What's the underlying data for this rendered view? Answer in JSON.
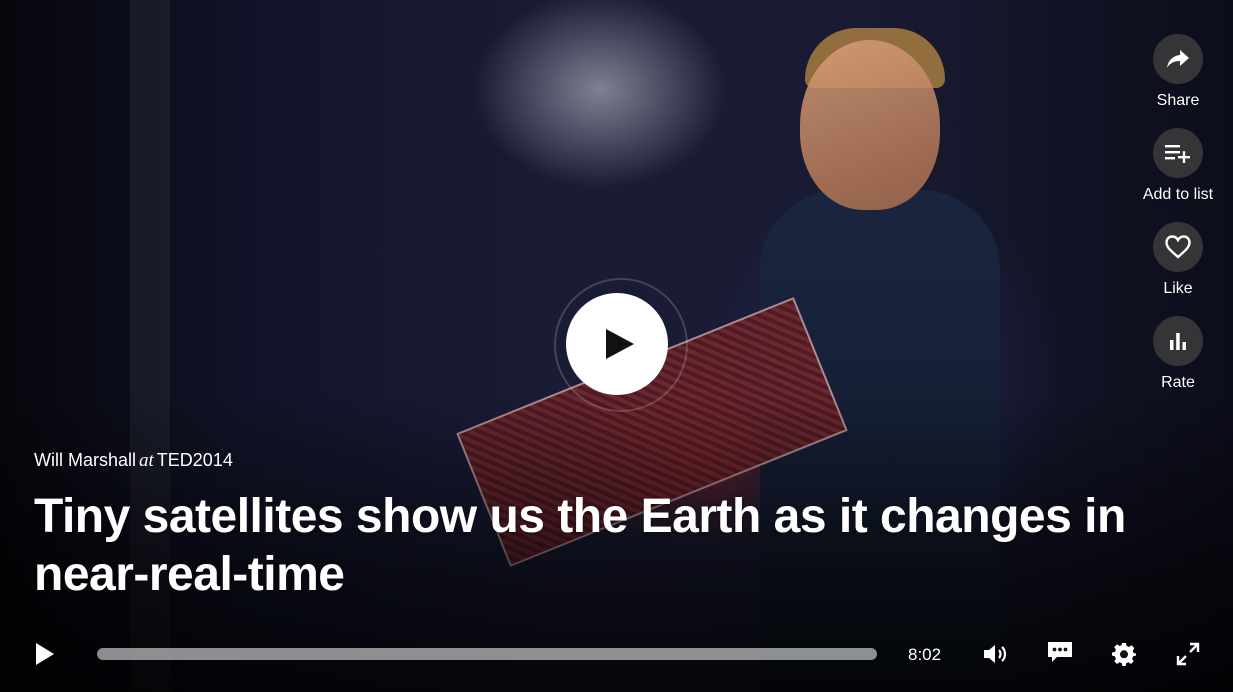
{
  "talk": {
    "speaker": "Will Marshall",
    "at_word": "at",
    "event": "TED2014",
    "title": "Tiny satellites show us the Earth as it changes in near-real-time"
  },
  "actions": [
    {
      "label": "Share",
      "icon": "share-icon"
    },
    {
      "label": "Add to list",
      "icon": "playlist-add-icon"
    },
    {
      "label": "Like",
      "icon": "heart-icon"
    },
    {
      "label": "Rate",
      "icon": "bar-chart-icon"
    }
  ],
  "controls": {
    "duration": "8:02",
    "progress_fraction": 0
  },
  "colors": {
    "overlay_button_bg": "#3c3c3c",
    "text": "#ffffff"
  }
}
